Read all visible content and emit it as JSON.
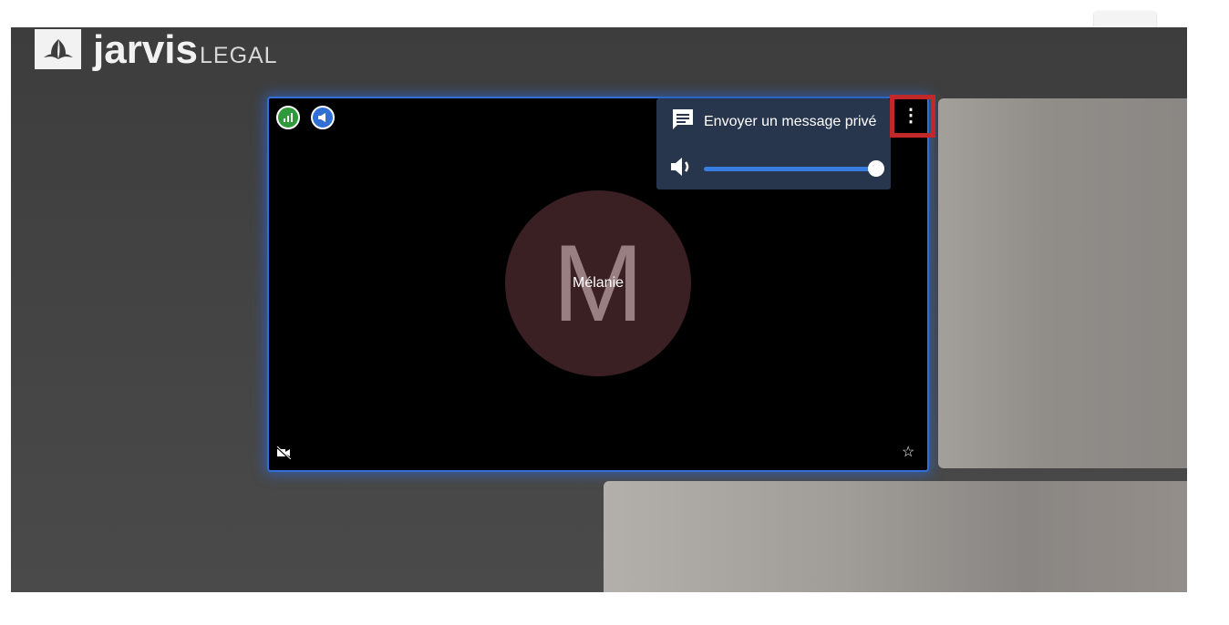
{
  "app": {
    "brand": "jarvis",
    "brand_sub": "LEGAL",
    "logo_icon": "lotus-icon"
  },
  "tile": {
    "participant_name": "Mélanie",
    "avatar_letter": "M",
    "badges": [
      "signal-quality-icon",
      "speaker-icon"
    ],
    "video_muted_icon": "video-off-icon",
    "favorite_icon": "star-icon",
    "border_color": "#2f6fd6"
  },
  "menu": {
    "private_message_label": "Envoyer un message privé",
    "private_message_icon": "chat-icon",
    "volume_icon": "volume-icon",
    "volume_level": 1.0
  },
  "more_button_icon": "more-vertical-icon",
  "highlight_color": "#c0282a"
}
